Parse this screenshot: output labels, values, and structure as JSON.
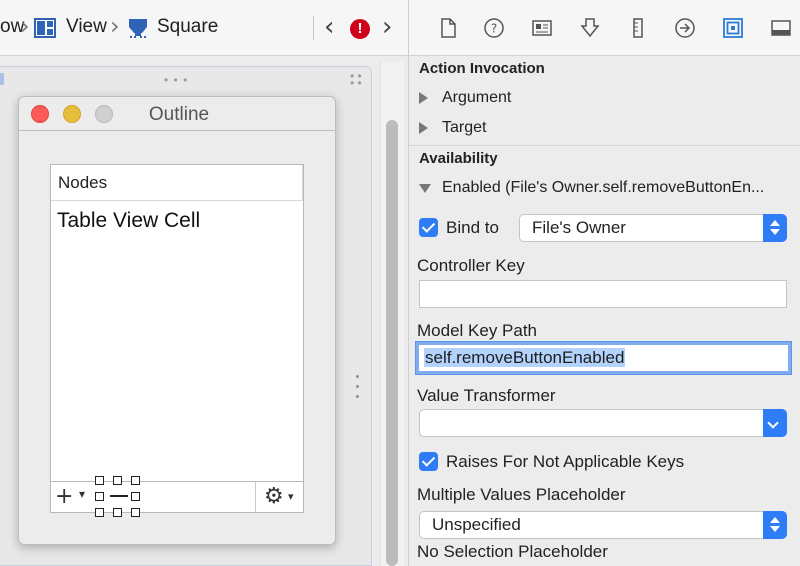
{
  "jumpbar": {
    "crumb_prev": "ow",
    "crumb_view": "View",
    "crumb_square": "Square",
    "back_glyph": "‹",
    "forward_glyph": "›",
    "error_glyph": "!"
  },
  "outline_window": {
    "title": "Outline",
    "column_header": "Nodes",
    "cell_text": "Table View Cell",
    "add_glyph": "+",
    "gear_glyph": "⚙"
  },
  "inspector": {
    "tabs": [
      "file-icon",
      "help-icon",
      "identity-icon",
      "attributes-icon",
      "size-icon",
      "connections-icon",
      "bindings-icon",
      "effects-icon"
    ],
    "active_tab": "bindings-icon",
    "action_invocation": {
      "heading": "Action Invocation",
      "argument": "Argument",
      "target": "Target"
    },
    "availability": {
      "heading": "Availability",
      "enabled": "Enabled (File's Owner.self.removeButtonEn...",
      "bind_to_label": "Bind to",
      "bind_to_value": "File's Owner",
      "controller_key_label": "Controller Key",
      "controller_key_value": "",
      "model_key_path_label": "Model Key Path",
      "model_key_path_value": "self.removeButtonEnabled",
      "value_transformer_label": "Value Transformer",
      "value_transformer_value": "",
      "raises_label": "Raises For Not Applicable Keys",
      "multiple_values_label": "Multiple Values Placeholder",
      "multiple_values_value": "Unspecified",
      "no_selection_label": "No Selection Placeholder"
    },
    "accent_color": "#2e7cf6"
  }
}
